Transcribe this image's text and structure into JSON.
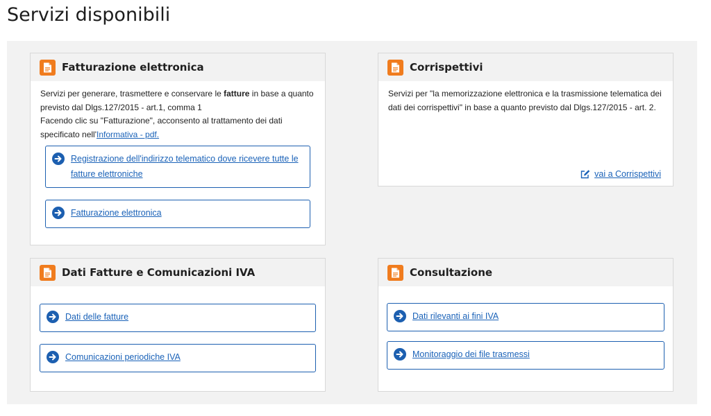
{
  "page": {
    "title": "Servizi disponibili"
  },
  "cards": {
    "fatturazione": {
      "title": "Fatturazione elettronica",
      "desc_pre": "Servizi per generare, trasmettere e conservare le ",
      "desc_bold": "fatture",
      "desc_post": " in base a quanto previsto dal Dlgs.127/2015 - art.1, comma 1",
      "consent_pre": "Facendo clic su \"Fatturazione\", acconsento al trattamento dei dati specificato nell'",
      "consent_link": "Informativa - pdf.",
      "buttons": [
        {
          "label": "Registrazione dell'indirizzo telematico dove ricevere tutte le fatture elettroniche"
        },
        {
          "label": "Fatturazione elettronica"
        }
      ]
    },
    "corrispettivi": {
      "title": "Corrispettivi",
      "desc": "Servizi per \"la memorizzazione elettronica e la trasmissione telematica dei dati dei corrispettivi\" in base a quanto previsto dal Dlgs.127/2015 - art. 2.",
      "link": "vai a Corrispettivi"
    },
    "dati_fatture": {
      "title": "Dati Fatture e Comunicazioni IVA",
      "buttons": [
        {
          "label": "Dati delle fatture"
        },
        {
          "label": "Comunicazioni periodiche IVA"
        }
      ]
    },
    "consultazione": {
      "title": "Consultazione",
      "buttons": [
        {
          "label": "Dati rilevanti ai fini IVA"
        },
        {
          "label": "Monitoraggio dei file trasmessi"
        }
      ]
    }
  },
  "colors": {
    "accent": "#1c5fb0",
    "icon_bg": "#f07c1e",
    "panel_bg": "#f2f2f2"
  },
  "icons": {
    "card": "document-icon",
    "button": "arrow-right-circle-icon",
    "link": "edit-icon"
  }
}
